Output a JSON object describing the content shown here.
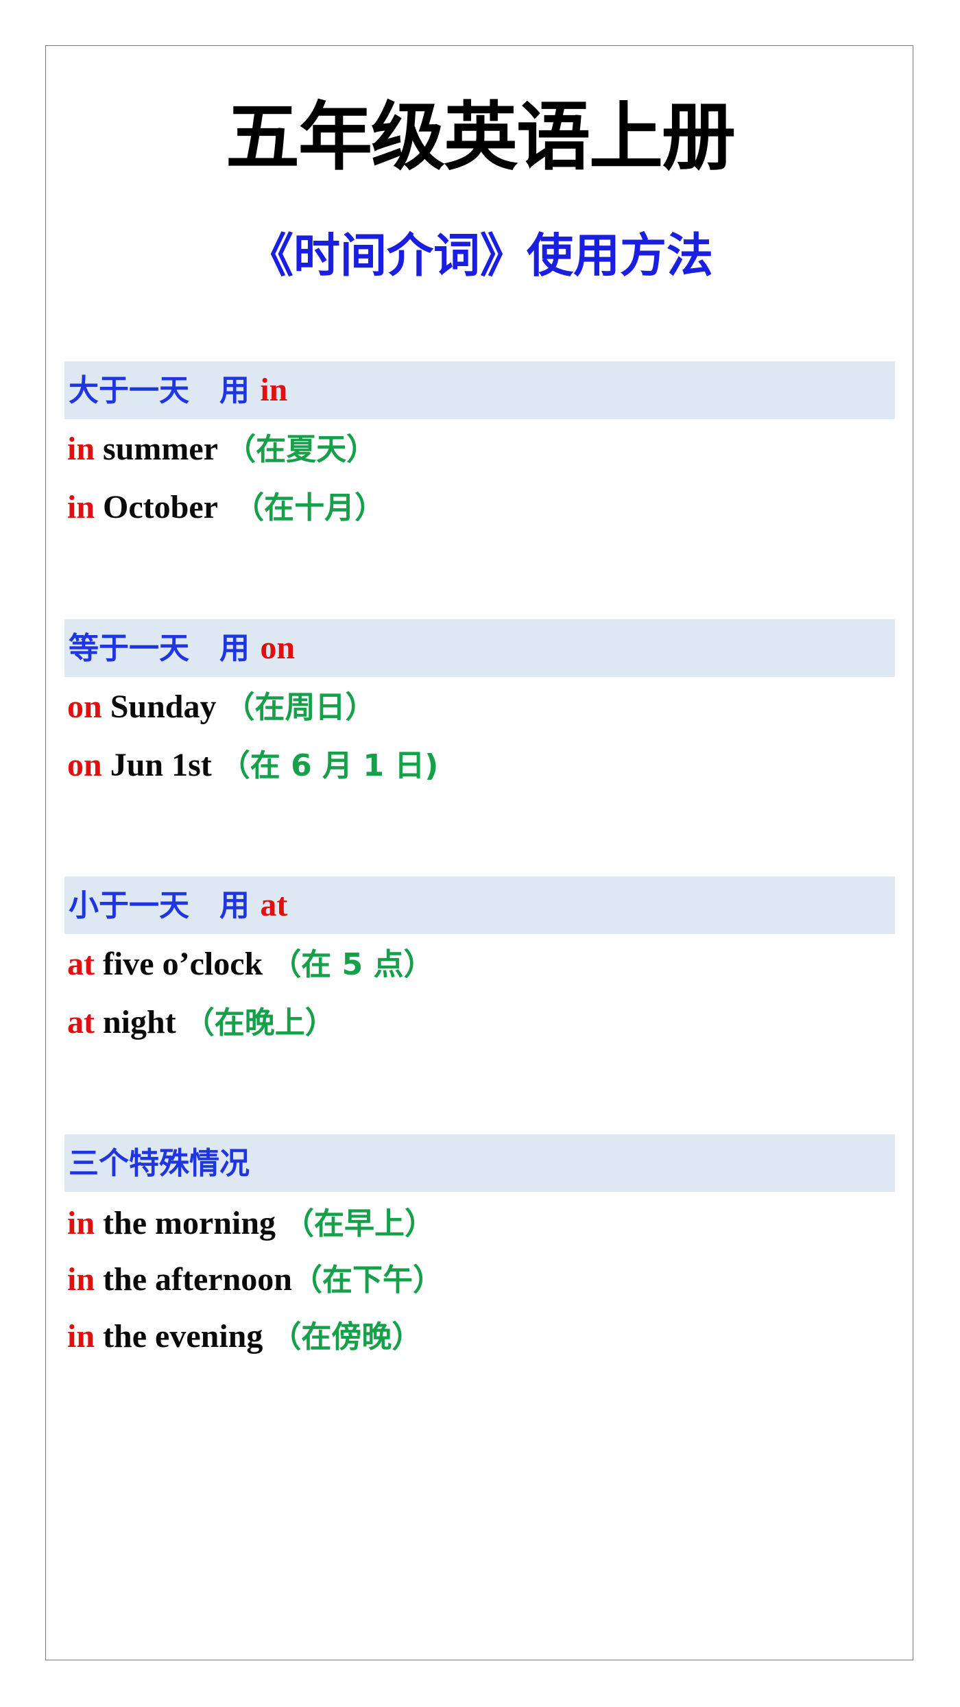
{
  "title": "五年级英语上册",
  "subtitle": "《时间介词》使用方法",
  "colors": {
    "title": "#000000",
    "subtitle": "#1a1ee0",
    "heading": "#1f35e0",
    "preposition": "#e01010",
    "english": "#0a0a0a",
    "translation": "#16a04a",
    "heading_bar": "#dde8f3"
  },
  "sections": [
    {
      "heading": "大于一天　用 ",
      "heading_prep": "in",
      "rows": [
        {
          "prep": "in",
          "en": " summer ",
          "zh": "（在夏天）"
        },
        {
          "prep": "in",
          "en": " October  ",
          "zh": "（在十月）"
        }
      ]
    },
    {
      "heading": "等于一天　用 ",
      "heading_prep": "on",
      "rows": [
        {
          "prep": "on",
          "en": " Sunday ",
          "zh": "（在周日）"
        },
        {
          "prep": "on",
          "en": " Jun 1st ",
          "zh": "（在 6 月 1 日)"
        }
      ]
    },
    {
      "heading": "小于一天　用 ",
      "heading_prep": "at",
      "rows": [
        {
          "prep": "at",
          "en": " five o’clock ",
          "zh": "（在 5 点）"
        },
        {
          "prep": "at",
          "en": " night ",
          "zh": "（在晚上）"
        }
      ]
    },
    {
      "heading": "三个特殊情况",
      "heading_prep": "",
      "rows": [
        {
          "prep": "in",
          "en": " the morning ",
          "zh": "（在早上）"
        },
        {
          "prep": "in",
          "en": " the afternoon",
          "zh": "（在下午）"
        },
        {
          "prep": "in",
          "en": " the evening ",
          "zh": "（在傍晚）"
        }
      ]
    }
  ]
}
